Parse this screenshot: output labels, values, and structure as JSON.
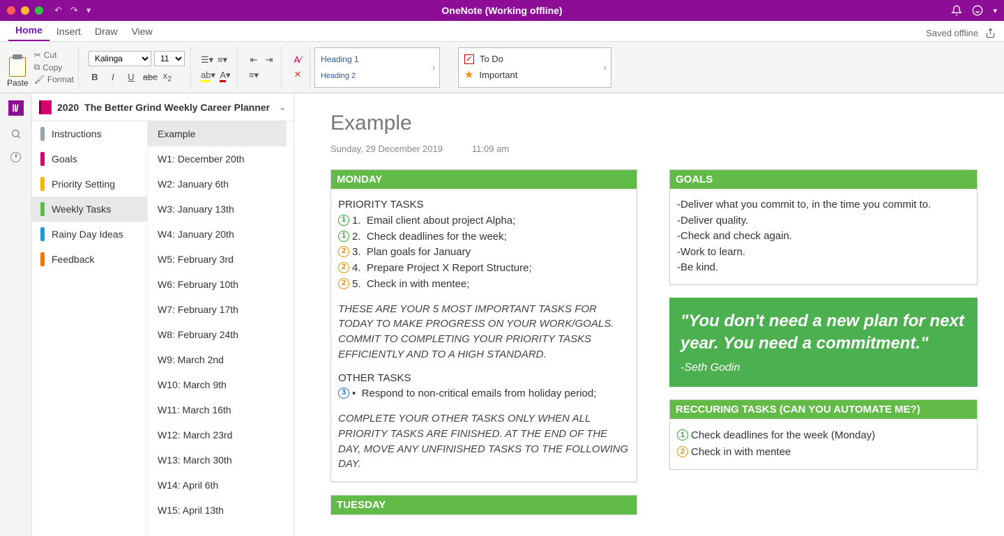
{
  "titlebar": {
    "title": "OneNote (Working offline)"
  },
  "tabs": {
    "items": [
      "Home",
      "Insert",
      "Draw",
      "View"
    ],
    "active": 0,
    "saved": "Saved offline"
  },
  "ribbon": {
    "paste": "Paste",
    "cut": "Cut",
    "copy": "Copy",
    "format": "Format",
    "font": "Kalinga",
    "size": "11",
    "heading1": "Heading 1",
    "heading2": "Heading 2",
    "todo": "To Do",
    "important": "Important"
  },
  "notebook": {
    "year": "2020",
    "name": "The Better Grind Weekly Career Planner"
  },
  "sections": [
    {
      "label": "Instructions",
      "color": "#9aa3ab"
    },
    {
      "label": "Goals",
      "color": "#d6006c"
    },
    {
      "label": "Priority Setting",
      "color": "#f2b900"
    },
    {
      "label": "Weekly Tasks",
      "color": "#62bb46"
    },
    {
      "label": "Rainy Day Ideas",
      "color": "#1f9bd8"
    },
    {
      "label": "Feedback",
      "color": "#f07800"
    }
  ],
  "sectionSelected": 3,
  "pages": [
    "Example",
    "W1: December 20th",
    "W2: January 6th",
    "W3: January 13th",
    "W4: January 20th",
    "W5: February 3rd",
    "W6: February 10th",
    "W7: February 17th",
    "W8: February 24th",
    "W9: March 2nd",
    "W10: March 9th",
    "W11: March 16th",
    "W12: March 23rd",
    "W13: March 30th",
    "W14: April 6th",
    "W15: April 13th"
  ],
  "pageSelected": 0,
  "note": {
    "title": "Example",
    "date": "Sunday, 29 December 2019",
    "time": "11:09 am",
    "monday": {
      "heading": "MONDAY",
      "priorityLabel": "PRIORITY TASKS",
      "tasks": [
        {
          "p": 1,
          "n": "1.",
          "t": "Email client about project Alpha;"
        },
        {
          "p": 1,
          "n": "2.",
          "t": "Check deadlines for the week;"
        },
        {
          "p": 2,
          "n": "3.",
          "t": "Plan goals for January"
        },
        {
          "p": 2,
          "n": "4.",
          "t": "Prepare Project X Report Structure;"
        },
        {
          "p": 2,
          "n": "5.",
          "t": "Check in with mentee;"
        }
      ],
      "note1": "THESE ARE YOUR 5 MOST IMPORTANT TASKS FOR TODAY TO MAKE PROGRESS ON YOUR WORK/GOALS. COMMIT TO COMPLETING YOUR PRIORITY TASKS EFFICIENTLY AND TO A HIGH STANDARD.",
      "otherLabel": "OTHER TASKS",
      "other": [
        {
          "p": 3,
          "n": "•",
          "t": "Respond to non-critical emails from holiday period;"
        }
      ],
      "note2": "COMPLETE YOUR OTHER TASKS ONLY WHEN ALL PRIORITY TASKS ARE FINISHED. AT THE END OF THE DAY, MOVE ANY UNFINISHED TASKS TO THE FOLLOWING DAY."
    },
    "tuesday": "TUESDAY",
    "goals": {
      "heading": "GOALS",
      "items": [
        "-Deliver what you commit to, in the time you commit to.",
        "-Deliver quality.",
        "-Check and check again.",
        "-Work to learn.",
        "-Be kind."
      ]
    },
    "quote": {
      "text": "\"You don't need a new plan for next year. You need a commitment.\"",
      "author": "-Seth Godin"
    },
    "recurring": {
      "heading": "RECCURING TASKS (CAN YOU AUTOMATE ME?)",
      "items": [
        {
          "p": 1,
          "t": "Check deadlines for the week (Monday)"
        },
        {
          "p": 2,
          "t": "Check in with mentee"
        }
      ]
    }
  }
}
